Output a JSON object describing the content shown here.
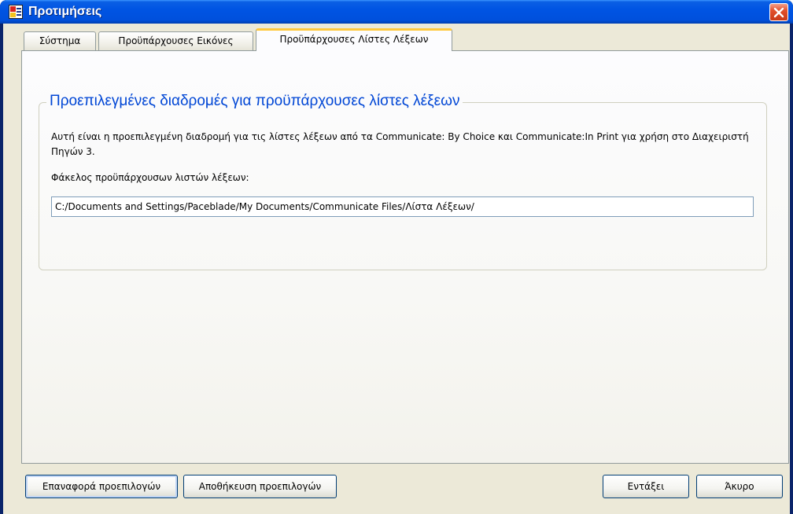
{
  "window": {
    "title": "Προτιμήσεις",
    "icon": "app-icon",
    "close_icon": "close-icon"
  },
  "tabs": [
    {
      "label": "Σύστημα",
      "active": false
    },
    {
      "label": "Προϋπάρχουσες Εικόνες",
      "active": false
    },
    {
      "label": "Προϋπάρχουσες Λίστες Λέξεων",
      "active": true
    }
  ],
  "group": {
    "legend": "Προεπιλεγμένες διαδρομές για προϋπάρχουσες λίστες λέξεων",
    "description": "Αυτή είναι η προεπιλεγμένη διαδρομή για τις λίστες λέξεων από τα Communicate: By Choice και Communicate:In Print για χρήση στο Διαχειριστή Πηγών 3.",
    "folder_label": "Φάκελος προϋπάρχουσων λιστών λέξεων:",
    "folder_path": "C:/Documents and Settings/Paceblade/My Documents/Communicate Files/Λίστα Λέξεων/"
  },
  "buttons": {
    "reset_defaults": "Επαναφορά προεπιλογών",
    "save_defaults": "Αποθήκευση προεπιλογών",
    "ok": "Εντάξει",
    "cancel": "Άκυρο"
  },
  "colors": {
    "titlebar": "#0054e3",
    "legend_text": "#0046d5",
    "active_tab_accent": "#ffc83c",
    "dialog_background": "#ece9d8"
  }
}
